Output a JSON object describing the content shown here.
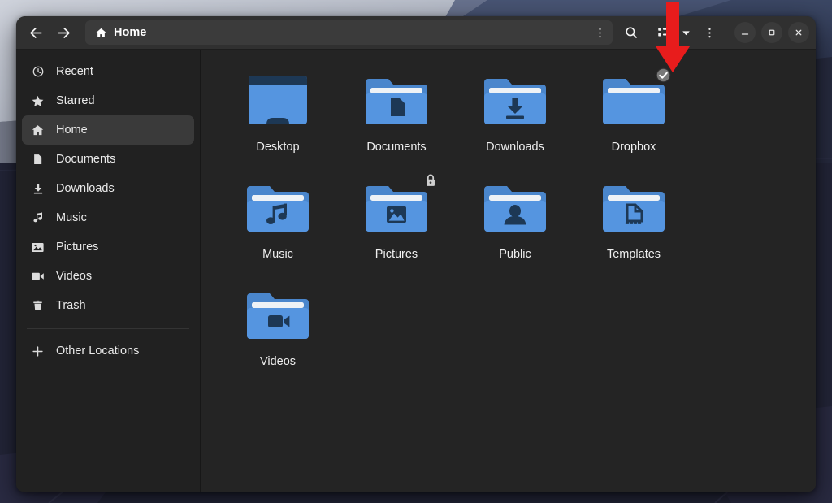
{
  "window": {
    "title": "Home",
    "colors": {
      "header_bg": "#303030",
      "sidebar_bg": "#212121",
      "content_bg": "#242424",
      "accent_selected": "#3a3a3a",
      "folder_blue": "#5595e0",
      "folder_blue_dark": "#1d3855",
      "annotation_red": "#e81c1c"
    }
  },
  "header": {
    "back_label": "Back",
    "forward_label": "Forward",
    "path_label": "Home",
    "path_icon": "home-icon",
    "path_menu_icon": "kebab-menu-icon",
    "search_icon": "search-icon",
    "view_toggle_icon": "list-view-icon",
    "view_dropdown_icon": "chevron-down-icon",
    "main_menu_icon": "kebab-menu-icon",
    "minimize_label": "Minimize",
    "maximize_label": "Maximize",
    "close_label": "Close"
  },
  "sidebar": {
    "items": [
      {
        "label": "Recent",
        "icon": "clock-icon",
        "active": false
      },
      {
        "label": "Starred",
        "icon": "star-icon",
        "active": false
      },
      {
        "label": "Home",
        "icon": "home-icon",
        "active": true
      },
      {
        "label": "Documents",
        "icon": "document-icon",
        "active": false
      },
      {
        "label": "Downloads",
        "icon": "download-icon",
        "active": false
      },
      {
        "label": "Music",
        "icon": "music-note-icon",
        "active": false
      },
      {
        "label": "Pictures",
        "icon": "image-icon",
        "active": false
      },
      {
        "label": "Videos",
        "icon": "video-icon",
        "active": false
      },
      {
        "label": "Trash",
        "icon": "trash-icon",
        "active": false
      }
    ],
    "other_locations": {
      "label": "Other Locations",
      "icon": "plus-icon"
    }
  },
  "content": {
    "items": [
      {
        "label": "Desktop",
        "icon": "folder-desktop-icon",
        "emblem": "monitor",
        "badge": null
      },
      {
        "label": "Documents",
        "icon": "folder-documents-icon",
        "emblem": "document",
        "badge": null
      },
      {
        "label": "Downloads",
        "icon": "folder-downloads-icon",
        "emblem": "download",
        "badge": null
      },
      {
        "label": "Dropbox",
        "icon": "folder-dropbox-icon",
        "emblem": "none",
        "badge": "check-badge-icon"
      },
      {
        "label": "Music",
        "icon": "folder-music-icon",
        "emblem": "music",
        "badge": null
      },
      {
        "label": "Pictures",
        "icon": "folder-pictures-icon",
        "emblem": "image",
        "badge": "lock-badge-icon"
      },
      {
        "label": "Public",
        "icon": "folder-public-icon",
        "emblem": "person",
        "badge": null
      },
      {
        "label": "Templates",
        "icon": "folder-templates-icon",
        "emblem": "template",
        "badge": null
      },
      {
        "label": "Videos",
        "icon": "folder-videos-icon",
        "emblem": "video",
        "badge": null
      }
    ]
  },
  "annotation": {
    "arrow": {
      "icon": "down-arrow-annotation",
      "color": "#e81c1c",
      "points_to": "list-view-icon"
    }
  }
}
